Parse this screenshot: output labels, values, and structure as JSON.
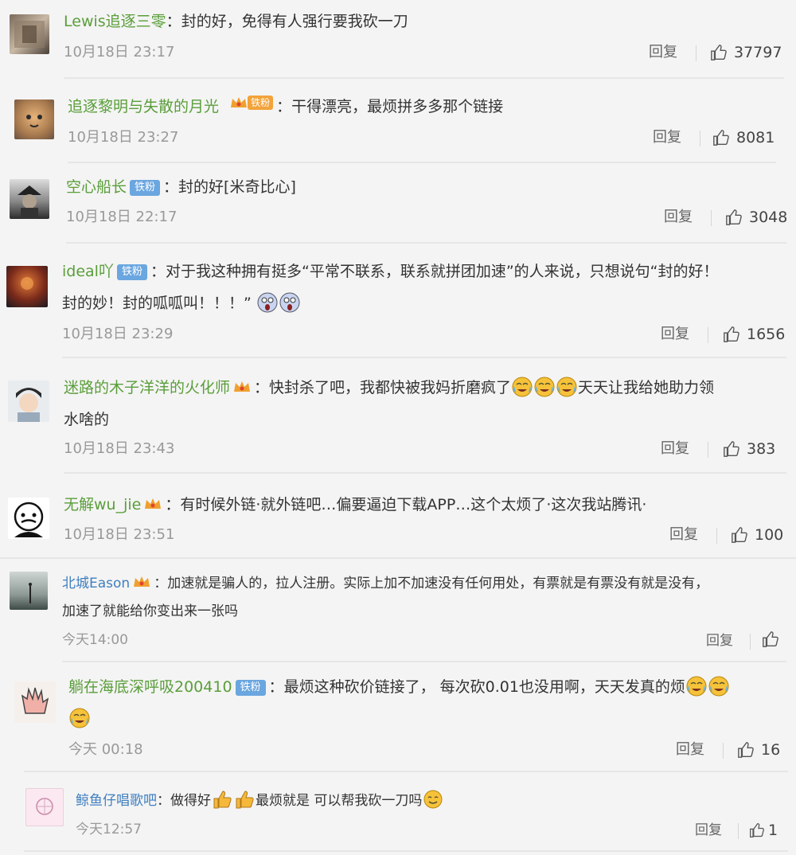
{
  "labels": {
    "reply": "回复",
    "separator": "："
  },
  "badges": {
    "tiefen": "铁粉"
  },
  "comments": [
    {
      "user": "Lewis追逐三零",
      "text1": "封的好，免得有人强行要我砍一刀",
      "time": "10月18日 23:17",
      "likes": "37797"
    },
    {
      "user": "追逐黎明与失散的月光",
      "text1": "干得漂亮，最烦拼多多那个链接",
      "time": "10月18日 23:27",
      "likes": "8081"
    },
    {
      "user": "空心船长",
      "text1": "封的好[米奇比心]",
      "time": "10月18日 22:17",
      "likes": "3048"
    },
    {
      "user": "ideal吖",
      "text1": "对于我这种拥有挺多“平常不联系，联系就拼团加速”的人来说，只想说句“封的好！",
      "text2": "封的妙！封的呱呱叫！！！”",
      "time": "10月18日 23:29",
      "likes": "1656"
    },
    {
      "user": "迷路的木子洋洋的火化师",
      "text1": "快封杀了吧，我都快被我妈折磨疯了",
      "text1b": "天天让我给她助力领",
      "text2": "水啥的",
      "time": "10月18日 23:43",
      "likes": "383"
    },
    {
      "user": "无解wu_jie",
      "text1": "有时候外链·就外链吧…偏要逼迫下载APP…这个太烦了·这次我站腾讯·",
      "time": "10月18日 23:51",
      "likes": "100"
    },
    {
      "user": "北城Eason",
      "text1": "加速就是骗人的，拉人注册。实际上加不加速没有任何用处，有票就是有票没有就是没有，",
      "text2": "加速了就能给你变出来一张吗",
      "time": "今天14:00",
      "likes": ""
    },
    {
      "user": "躺在海底深呼吸200410",
      "text1": "最烦这种砍价链接了， 每次砍0.01也没用啊，天天发真的烦",
      "time": "今天 00:18",
      "likes": "16"
    },
    {
      "user": "鲸鱼仔唱歌吧",
      "text1a": "做得好",
      "text1b": "最烦就是 可以帮我砍一刀吗",
      "time": "今天12:57",
      "likes": "1"
    }
  ],
  "colors": {
    "username_green": "#5a9e3a",
    "username_blue": "#3f7fbf",
    "badge_blue": "#6aa6e0",
    "background": "#f4f4f4"
  },
  "icons": [
    "thumbs-up-icon",
    "crown-icon",
    "crying-laugh-emoji",
    "screaming-emoji",
    "thumbs-up-emoji",
    "smile-emoji"
  ]
}
